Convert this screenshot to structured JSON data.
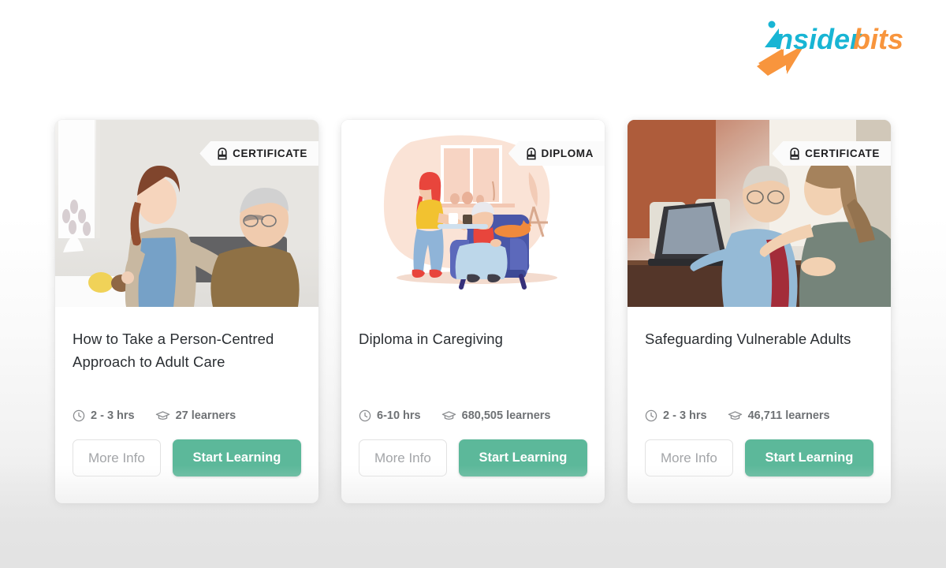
{
  "brand": {
    "name_part1": "insider",
    "name_part2": "bits",
    "color_primary": "#18b5d4",
    "color_accent": "#f8953d"
  },
  "theme": {
    "accent_green": "#5cb89a",
    "page_background_top": "#ffffff",
    "page_background_bottom": "#e3e3e3",
    "card_background": "#ffffff",
    "title_color": "#2b2f33",
    "meta_color": "#6f7275",
    "ghost_button_text": "#a3a5a8"
  },
  "cards": [
    {
      "badge_label": "CERTIFICATE",
      "badge_icon": "award-icon",
      "title": "How to Take a Person-Centred Approach to Adult Care",
      "duration": "2 - 3 hrs",
      "duration_icon": "clock-icon",
      "learners": "27 learners",
      "learners_icon": "graduation-cap-icon",
      "more_info_label": "More Info",
      "start_label": "Start Learning",
      "image_alt": "photo-caregiver-with-elderly-man-at-table"
    },
    {
      "badge_label": "DIPLOMA",
      "badge_icon": "award-icon",
      "title": "Diploma in Caregiving",
      "duration": "6-10 hrs",
      "duration_icon": "clock-icon",
      "learners": "680,505 learners",
      "learners_icon": "graduation-cap-icon",
      "more_info_label": "More Info",
      "start_label": "Start Learning",
      "image_alt": "illustration-caregiver-serving-tray-to-elderly-woman-in-armchair"
    },
    {
      "badge_label": "CERTIFICATE",
      "badge_icon": "award-icon",
      "title": "Safeguarding Vulnerable Adults",
      "duration": "2 - 3 hrs",
      "duration_icon": "clock-icon",
      "learners": "46,711 learners",
      "learners_icon": "graduation-cap-icon",
      "more_info_label": "More Info",
      "start_label": "Start Learning",
      "image_alt": "photo-elderly-man-and-young-woman-using-laptop"
    }
  ]
}
